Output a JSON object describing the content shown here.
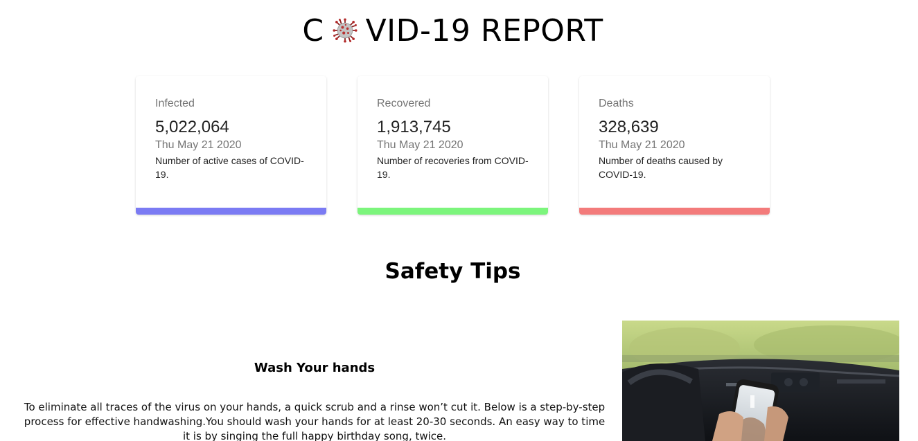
{
  "header": {
    "title_prefix": "C",
    "title_suffix": "VID-19 REPORT",
    "logo_icon": "coronavirus-icon"
  },
  "cards": [
    {
      "label": "Infected",
      "count": "5,022,064",
      "date": "Thu May 21 2020",
      "description": "Number of active cases of COVID-19.",
      "color": "#7b7bf3"
    },
    {
      "label": "Recovered",
      "count": "1,913,745",
      "date": "Thu May 21 2020",
      "description": "Number of recoveries from COVID-19.",
      "color": "#7cf57c"
    },
    {
      "label": "Deaths",
      "count": "328,639",
      "date": "Thu May 21 2020",
      "description": "Number of deaths caused by COVID-19.",
      "color": "#f37b7b"
    }
  ],
  "safety": {
    "title": "Safety Tips",
    "tips": [
      {
        "title": "Wash Your hands",
        "text": "To eliminate all traces of the virus on your hands, a quick scrub and a rinse won’t cut it. Below is a step-by-step process for effective handwashing.You should wash your hands for at least 20-30 seconds. An easy way to time it is by singing the full happy birthday song, twice.",
        "image_icon": "hand-sanitizer-photo"
      }
    ]
  }
}
